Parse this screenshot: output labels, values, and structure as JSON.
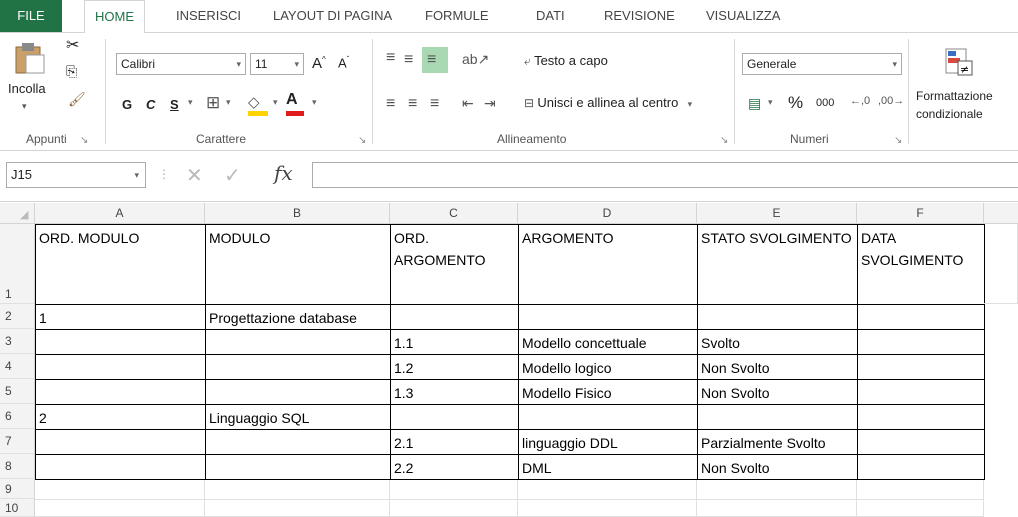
{
  "tabs": [
    "FILE",
    "HOME",
    "INSERISCI",
    "LAYOUT DI PAGINA",
    "FORMULE",
    "DATI",
    "REVISIONE",
    "VISUALIZZA"
  ],
  "clipboard": {
    "paste_label": "Incolla",
    "group": "Appunti"
  },
  "font": {
    "name": "Calibri",
    "size": "11",
    "bold": "G",
    "italic": "C",
    "underline": "S",
    "group": "Carattere"
  },
  "alignment": {
    "wrap": "Testo a capo",
    "merge": "Unisci e allinea al centro",
    "group": "Allineamento"
  },
  "number": {
    "format": "Generale",
    "percent": "%",
    "thousands": "000",
    "group": "Numeri"
  },
  "styles": {
    "cond_line1": "Formattazione",
    "cond_line2": "condizionale"
  },
  "namebox": "J15",
  "fx": "fx",
  "columns": [
    "A",
    "B",
    "C",
    "D",
    "E",
    "F"
  ],
  "rows": [
    "1",
    "2",
    "3",
    "4",
    "5",
    "6",
    "7",
    "8",
    "9",
    "10"
  ],
  "sheet": {
    "headers": [
      "ORD. MODULO",
      "MODULO",
      "ORD. ARGOMENTO",
      "ARGOMENTO",
      "STATO SVOLGIMENTO",
      "DATA SVOLGIMENTO"
    ],
    "data": [
      [
        "1",
        "Progettazione database",
        "",
        "",
        "",
        ""
      ],
      [
        "",
        "",
        "1.1",
        "Modello concettuale",
        "Svolto",
        ""
      ],
      [
        "",
        "",
        "1.2",
        "Modello logico",
        "Non Svolto",
        ""
      ],
      [
        "",
        "",
        "1.3",
        "Modello Fisico",
        "Non Svolto",
        ""
      ],
      [
        "2",
        "Linguaggio SQL",
        "",
        "",
        "",
        ""
      ],
      [
        "",
        "",
        "2.1",
        "linguaggio DDL",
        "Parzialmente Svolto",
        ""
      ],
      [
        "",
        "",
        "2.2",
        "DML",
        "Non Svolto",
        ""
      ]
    ]
  },
  "colors": {
    "accent": "#217346",
    "fill_highlight": "#ffd200",
    "font_color": "#e01b1b"
  }
}
